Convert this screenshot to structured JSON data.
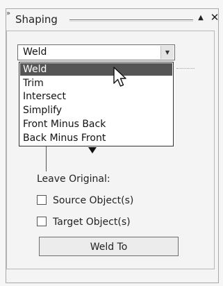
{
  "window": {
    "title": "Shaping",
    "grip_glyph": "»",
    "pin_glyph": "▲",
    "close_glyph": "✕"
  },
  "combo": {
    "value": "Weld",
    "arrow_glyph": "▼"
  },
  "dropdown": {
    "items": [
      {
        "label": "Weld",
        "selected": true
      },
      {
        "label": "Trim",
        "selected": false
      },
      {
        "label": "Intersect",
        "selected": false
      },
      {
        "label": "Simplify",
        "selected": false
      },
      {
        "label": "Front Minus Back",
        "selected": false
      },
      {
        "label": "Back Minus Front",
        "selected": false
      }
    ]
  },
  "leave_original": {
    "label": "Leave Original:",
    "options": [
      {
        "label": "Source Object(s)",
        "checked": false
      },
      {
        "label": "Target Object(s)",
        "checked": false
      }
    ]
  },
  "action_button": {
    "label": "Weld To"
  },
  "icons": {
    "cursor": "arrow-pointer-icon"
  },
  "colors": {
    "selection": "#555555",
    "background": "#f4f4f4"
  }
}
